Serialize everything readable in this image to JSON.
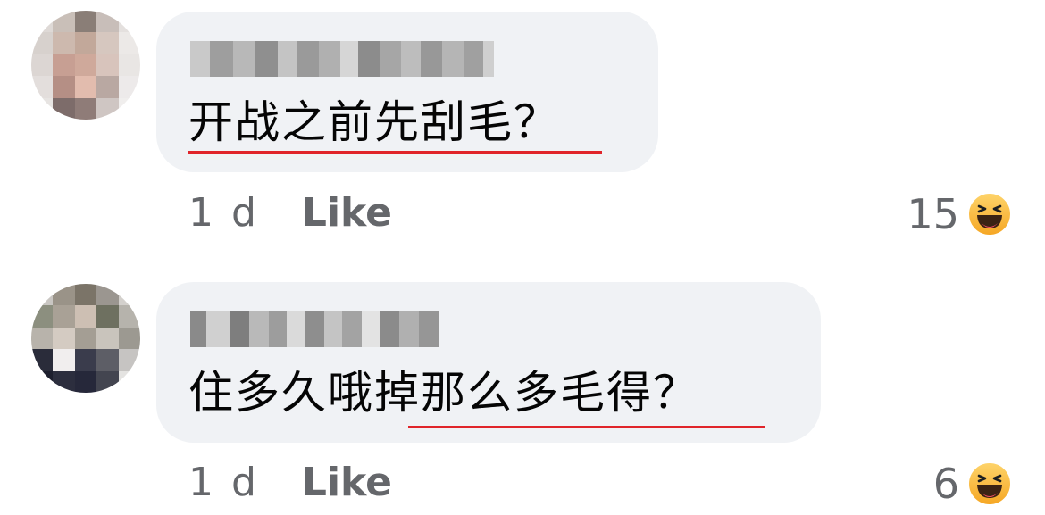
{
  "comments": [
    {
      "author_name": "",
      "text": "开战之前先刮毛？",
      "time": "1 d",
      "like_label": "Like",
      "reaction_count": "15",
      "reaction_icon": "haha-emoji-icon",
      "highlighted": true
    },
    {
      "author_name": "",
      "text_before": "住多久哦",
      "text_highlighted": "掉那么多毛得？",
      "time": "1 d",
      "like_label": "Like",
      "reaction_count": "6",
      "reaction_icon": "haha-emoji-icon",
      "highlighted": true
    }
  ],
  "colors": {
    "bubble_bg": "#f0f2f5",
    "meta_text": "#65676b",
    "body_text": "#050505",
    "annotation_underline": "#e0242a",
    "emoji_yellow": "#f7b125"
  }
}
